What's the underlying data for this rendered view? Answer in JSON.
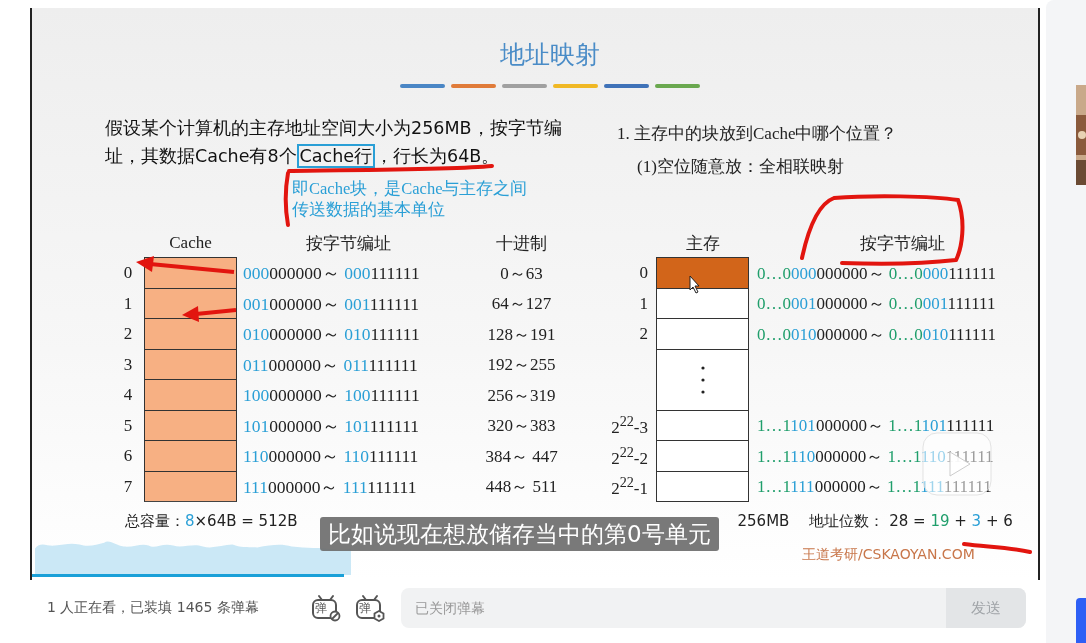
{
  "video": {
    "slide": {
      "title": "地址映射",
      "accent_bars": [
        {
          "color": "#4a86c5"
        },
        {
          "color": "#e07b39"
        },
        {
          "color": "#a0a0a0"
        },
        {
          "color": "#f0b824"
        },
        {
          "color": "#3f72b8"
        },
        {
          "color": "#6aa84f"
        }
      ],
      "problem": {
        "before": "假设某个计算机的主存地址空间大小为256MB，按字节编址，其数据Cache有8个",
        "boxed": "Cache行",
        "after": "，行长为64B。"
      },
      "note": "即Cache块，是Cache与主存之间传送数据的基本单位",
      "question": "1. 主存中的块放到Cache中哪个位置？",
      "answer": "(1)空位随意放：全相联映射",
      "range_sep": "～",
      "cache_table": {
        "columns": [
          "Cache",
          "按字节编址",
          "十进制"
        ],
        "rows": [
          {
            "index": "0",
            "start": [
              {
                "kind": "index",
                "text": "000"
              },
              {
                "kind": "offset",
                "text": "000000"
              }
            ],
            "end": [
              {
                "kind": "index",
                "text": "000"
              },
              {
                "kind": "offset",
                "text": "111111"
              }
            ],
            "decimal": "0～63"
          },
          {
            "index": "1",
            "start": [
              {
                "kind": "index",
                "text": "001"
              },
              {
                "kind": "offset",
                "text": "000000"
              }
            ],
            "end": [
              {
                "kind": "index",
                "text": "001"
              },
              {
                "kind": "offset",
                "text": "111111"
              }
            ],
            "decimal": "64～127"
          },
          {
            "index": "2",
            "start": [
              {
                "kind": "index",
                "text": "010"
              },
              {
                "kind": "offset",
                "text": "000000"
              }
            ],
            "end": [
              {
                "kind": "index",
                "text": "010"
              },
              {
                "kind": "offset",
                "text": "111111"
              }
            ],
            "decimal": "128～191"
          },
          {
            "index": "3",
            "start": [
              {
                "kind": "index",
                "text": "011"
              },
              {
                "kind": "offset",
                "text": "000000"
              }
            ],
            "end": [
              {
                "kind": "index",
                "text": "011"
              },
              {
                "kind": "offset",
                "text": "111111"
              }
            ],
            "decimal": "192～255"
          },
          {
            "index": "4",
            "start": [
              {
                "kind": "index",
                "text": "100"
              },
              {
                "kind": "offset",
                "text": "000000"
              }
            ],
            "end": [
              {
                "kind": "index",
                "text": "100"
              },
              {
                "kind": "offset",
                "text": "111111"
              }
            ],
            "decimal": "256～319"
          },
          {
            "index": "5",
            "start": [
              {
                "kind": "index",
                "text": "101"
              },
              {
                "kind": "offset",
                "text": "000000"
              }
            ],
            "end": [
              {
                "kind": "index",
                "text": "101"
              },
              {
                "kind": "offset",
                "text": "111111"
              }
            ],
            "decimal": "320～383"
          },
          {
            "index": "6",
            "start": [
              {
                "kind": "index",
                "text": "110"
              },
              {
                "kind": "offset",
                "text": "000000"
              }
            ],
            "end": [
              {
                "kind": "index",
                "text": "110"
              },
              {
                "kind": "offset",
                "text": "111111"
              }
            ],
            "decimal": "384～ 447"
          },
          {
            "index": "7",
            "start": [
              {
                "kind": "index",
                "text": "111"
              },
              {
                "kind": "offset",
                "text": "000000"
              }
            ],
            "end": [
              {
                "kind": "index",
                "text": "111"
              },
              {
                "kind": "offset",
                "text": "111111"
              }
            ],
            "decimal": "448～ 511"
          }
        ]
      },
      "memory_table": {
        "columns": [
          "主存",
          "按字节编址"
        ],
        "rows": [
          {
            "kind": "block",
            "label": "0",
            "highlighted": true,
            "start": [
              {
                "kind": "tag",
                "text": "0…0"
              },
              {
                "kind": "index",
                "text": "000"
              },
              {
                "kind": "offset",
                "text": "000000"
              }
            ],
            "end": [
              {
                "kind": "tag",
                "text": "0…0"
              },
              {
                "kind": "index",
                "text": "000"
              },
              {
                "kind": "offset",
                "text": "111111"
              }
            ]
          },
          {
            "kind": "block",
            "label": "1",
            "highlighted": false,
            "start": [
              {
                "kind": "tag",
                "text": "0…0"
              },
              {
                "kind": "index",
                "text": "001"
              },
              {
                "kind": "offset",
                "text": "000000"
              }
            ],
            "end": [
              {
                "kind": "tag",
                "text": "0…0"
              },
              {
                "kind": "index",
                "text": "001"
              },
              {
                "kind": "offset",
                "text": "111111"
              }
            ]
          },
          {
            "kind": "block",
            "label": "2",
            "highlighted": false,
            "start": [
              {
                "kind": "tag",
                "text": "0…0"
              },
              {
                "kind": "index",
                "text": "010"
              },
              {
                "kind": "offset",
                "text": "000000"
              }
            ],
            "end": [
              {
                "kind": "tag",
                "text": "0…0"
              },
              {
                "kind": "index",
                "text": "010"
              },
              {
                "kind": "offset",
                "text": "111111"
              }
            ]
          },
          {
            "kind": "gap"
          },
          {
            "kind": "block",
            "label": "2$^{22}$-3",
            "highlighted": false,
            "start": [
              {
                "kind": "tag",
                "text": "1…1"
              },
              {
                "kind": "index",
                "text": "101"
              },
              {
                "kind": "offset",
                "text": "000000"
              }
            ],
            "end": [
              {
                "kind": "tag",
                "text": "1…1"
              },
              {
                "kind": "index",
                "text": "101"
              },
              {
                "kind": "offset",
                "text": "111111"
              }
            ]
          },
          {
            "kind": "block",
            "label": "2$^{22}$-2",
            "highlighted": false,
            "start": [
              {
                "kind": "tag",
                "text": "1…1"
              },
              {
                "kind": "index",
                "text": "110"
              },
              {
                "kind": "offset",
                "text": "000000"
              }
            ],
            "end": [
              {
                "kind": "tag",
                "text": "1…1"
              },
              {
                "kind": "index",
                "text": "110"
              },
              {
                "kind": "offset",
                "text": "111111"
              }
            ]
          },
          {
            "kind": "block",
            "label": "2$^{22}$-1",
            "highlighted": false,
            "start": [
              {
                "kind": "tag",
                "text": "1…1"
              },
              {
                "kind": "index",
                "text": "111"
              },
              {
                "kind": "offset",
                "text": "000000"
              }
            ],
            "end": [
              {
                "kind": "tag",
                "text": "1…1"
              },
              {
                "kind": "index",
                "text": "111"
              },
              {
                "kind": "offset",
                "text": "111111"
              }
            ]
          }
        ]
      },
      "cache_capacity": {
        "label": "总容量：",
        "parts": [
          {
            "kind": "index",
            "text": "8"
          },
          {
            "kind": "offset",
            "text": "×64B = 512B"
          }
        ]
      },
      "memory_capacity": "256MB",
      "address_bits": {
        "label": "地址位数：",
        "parts": [
          {
            "kind": "offset",
            "text": "28 = "
          },
          {
            "kind": "tag",
            "text": "19"
          },
          {
            "kind": "offset",
            "text": " + "
          },
          {
            "kind": "index",
            "text": "3"
          },
          {
            "kind": "offset",
            "text": " + 6"
          }
        ]
      },
      "footer": "王道考研/CSKAOYAN.COM"
    },
    "subtitle": "比如说现在想放储存当中的第0号单元",
    "progress": {
      "level": 0.31
    }
  },
  "player_bar": {
    "viewers": "1 人正在看，已装填 1465 条弹幕",
    "danmaku_buttons": [
      {
        "kind": "block",
        "glyph": "弹"
      },
      {
        "kind": "settings",
        "glyph": "弹"
      }
    ],
    "input": {
      "placeholder": "已关闭弹幕"
    },
    "send": {
      "label": "发送",
      "disabled": true
    }
  }
}
